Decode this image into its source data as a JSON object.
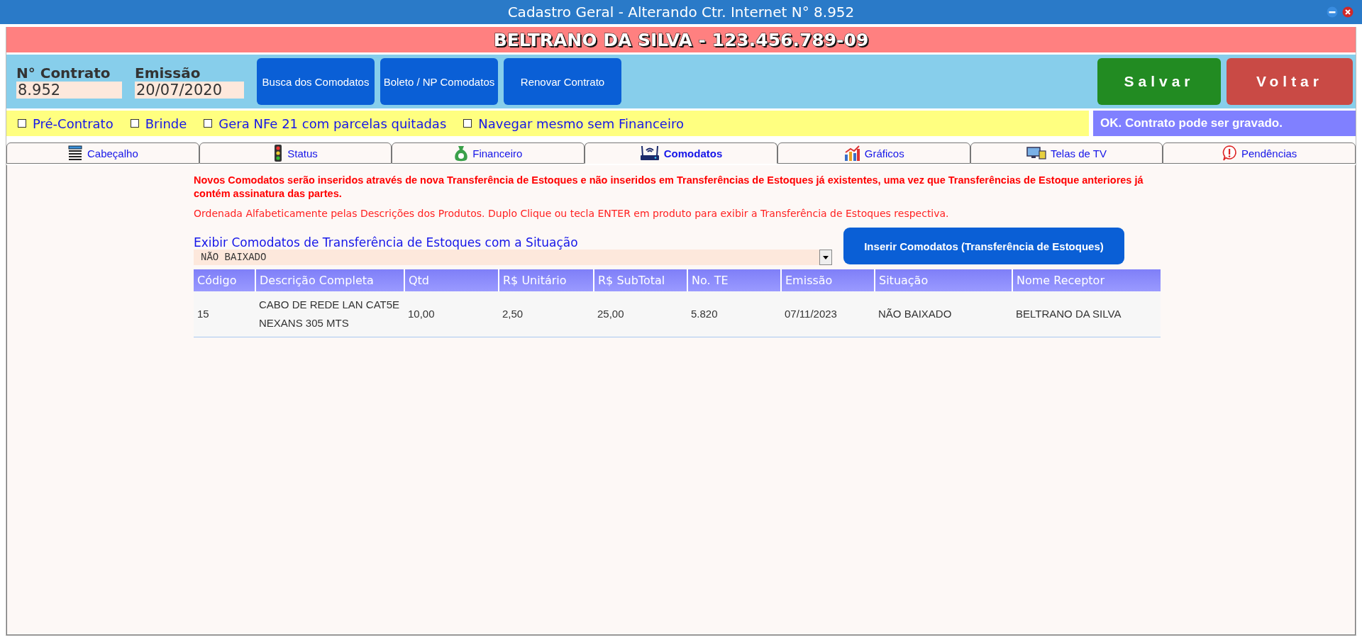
{
  "window": {
    "title": "Cadastro Geral - Alterando Ctr. Internet N° 8.952"
  },
  "banner": "BELTRANO DA SILVA - 123.456.789-09",
  "fields": [
    {
      "label": "N° Contrato",
      "value": "8.952"
    },
    {
      "label": "Emissão",
      "value": "20/07/2020"
    }
  ],
  "toolbar_buttons": [
    "Busca dos Comodatos",
    "Boleto / NP Comodatos",
    "Renovar Contrato"
  ],
  "action_buttons": [
    {
      "label": "Salvar",
      "kind": "save"
    },
    {
      "label": "Voltar",
      "kind": "back"
    }
  ],
  "options": [
    {
      "label": "Pré-Contrato",
      "checked": false
    },
    {
      "label": "Brinde",
      "checked": false
    },
    {
      "label": "Gera NFe 21 com parcelas quitadas",
      "checked": false
    },
    {
      "label": "Navegar mesmo sem Financeiro",
      "checked": false
    }
  ],
  "status_message": "OK. Contrato pode ser gravado.",
  "tabs": [
    {
      "label": "Cabeçalho",
      "selected": false
    },
    {
      "label": "Status",
      "selected": false
    },
    {
      "label": "Financeiro",
      "selected": false
    },
    {
      "label": "Comodatos",
      "selected": true
    },
    {
      "label": "Gráficos",
      "selected": false
    },
    {
      "label": "Telas de TV",
      "selected": false
    },
    {
      "label": "Pendências",
      "selected": false
    }
  ],
  "notice": "Novos Comodatos serão inseridos através de nova Transferência de Estoques e não inseridos em Transferências de Estoques já existentes, uma vez que Transferências de Estoque anteriores já contém assinatura das partes.",
  "hint": "Ordenada Alfabeticamente pelas Descrições dos Produtos. Duplo Clique ou tecla ENTER em produto para exibir a Transferência de Estoques respectiva.",
  "filter": {
    "label": "Exibir Comodatos de Transferência de Estoques com a Situação",
    "value": "NÃO BAIXADO"
  },
  "insert_button": "Inserir Comodatos (Transferência de Estoques)",
  "table": {
    "columns": [
      "Código",
      "Descrição Completa",
      "Qtd",
      "R$ Unitário",
      "R$ SubTotal",
      "No. TE",
      "Emissão",
      "Situação",
      "Nome Receptor"
    ],
    "rows": [
      [
        "15",
        "CABO DE REDE LAN CAT5E NEXANS 305 MTS",
        "10,00",
        "2,50",
        "25,00",
        "5.820",
        "07/11/2023",
        "NÃO BAIXADO",
        "BELTRANO DA SILVA"
      ]
    ]
  }
}
